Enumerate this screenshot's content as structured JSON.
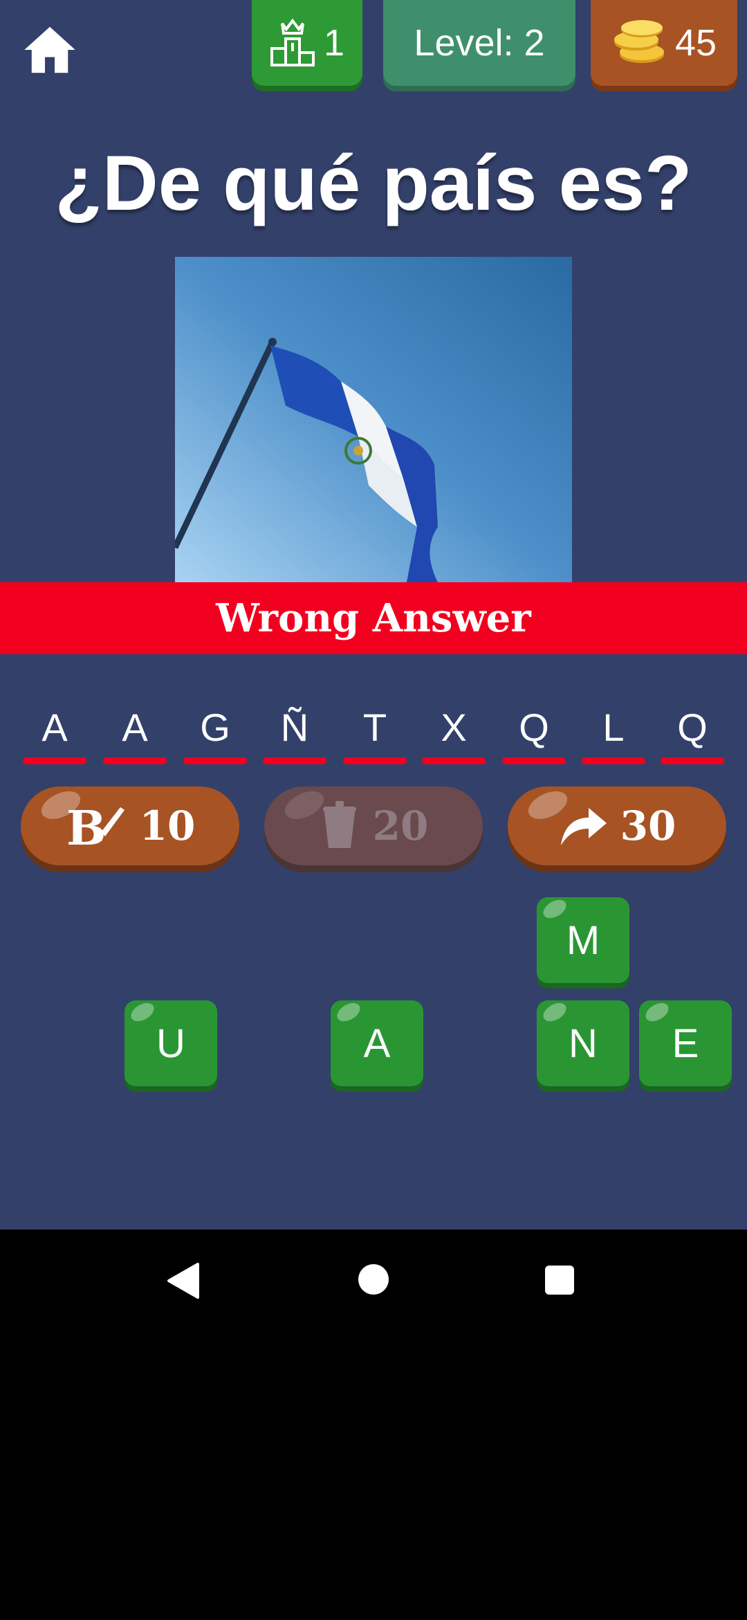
{
  "header": {
    "rank_value": "1",
    "level_label": "Level: 2",
    "coins_value": "45"
  },
  "question": "¿De qué país es?",
  "feedback_banner": "Wrong Answer",
  "answer_slots": [
    "A",
    "A",
    "G",
    "Ñ",
    "T",
    "X",
    "Q",
    "L",
    "Q"
  ],
  "hints": [
    {
      "icon": "paint-brush-icon",
      "cost": "10",
      "enabled": true
    },
    {
      "icon": "trash-icon",
      "cost": "20",
      "enabled": false
    },
    {
      "icon": "skip-arrow-icon",
      "cost": "30",
      "enabled": true
    }
  ],
  "tiles": [
    "M",
    "U",
    "A",
    "N",
    "E"
  ],
  "colors": {
    "background": "#33406a",
    "green": "#2a9633",
    "orange": "#a75324",
    "red": "#f2001f"
  }
}
